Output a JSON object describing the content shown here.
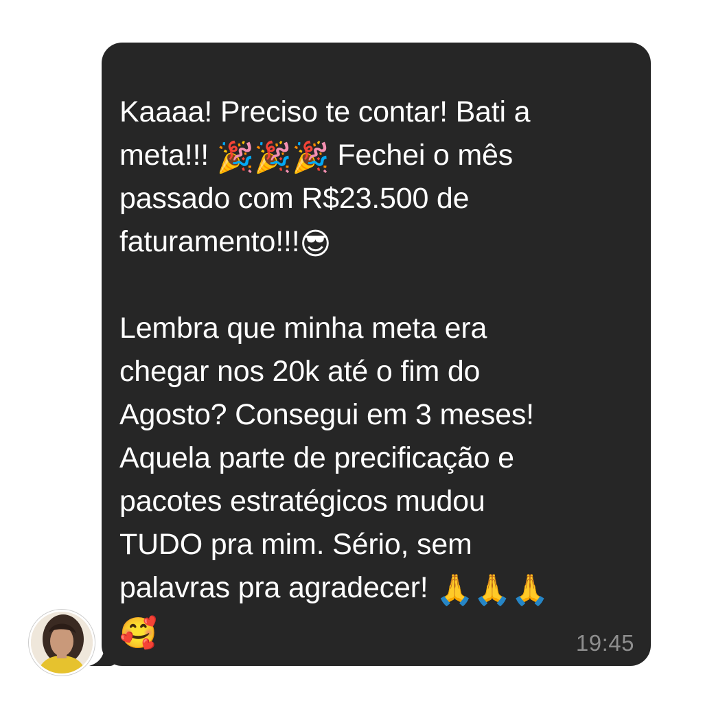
{
  "message": {
    "p1": {
      "line1": "Kaaaa! Preciso te contar! Bati a",
      "line2a": "meta!!!",
      "party_emoji": "🎉🎉🎉",
      "line2b": "Fechei o mês",
      "line3": "passado com R$23.500 de",
      "line4": "faturamento!!!",
      "cool_emoji": "😎"
    },
    "p2": {
      "line1": "Lembra que minha meta era",
      "line2": "chegar nos 20k até o fim do",
      "line3": "Agosto? Consegui em 3 meses!",
      "line4": "Aquela parte de precificação e",
      "line5": "pacotes estratégicos mudou",
      "line6": "TUDO pra mim. Sério, sem",
      "line7": "palavras pra agradecer!",
      "pray_emoji": "🙏🙏🙏",
      "love_emoji": "🥰"
    },
    "time": "19:45"
  },
  "colors": {
    "bubble": "#262626",
    "text": "#ffffff",
    "timestamp": "#8e8e8e"
  },
  "icons": {
    "avatar": "contact-avatar"
  }
}
